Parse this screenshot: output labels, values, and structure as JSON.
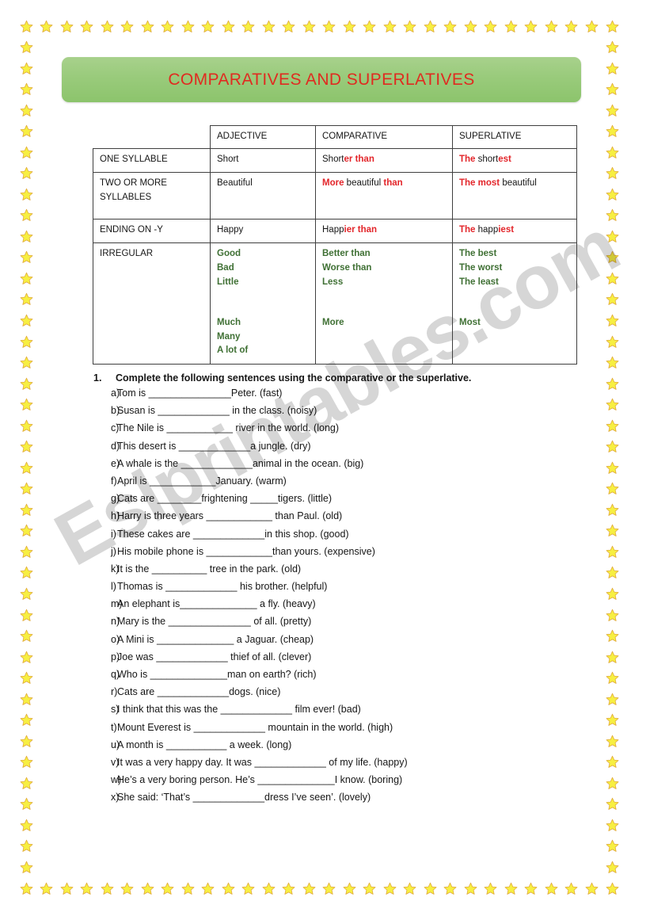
{
  "banner": {
    "title": "COMPARATIVES AND SUPERLATIVES",
    "bg_color": "#9acb7c",
    "title_color": "#e02b20"
  },
  "watermark": {
    "text": "Eslprintables.com"
  },
  "colors": {
    "red": "#e3252a",
    "green": "#3f7034",
    "border": "#3f3f3f"
  },
  "table": {
    "headers": [
      "",
      "ADJECTIVE",
      "COMPARATIVE",
      "SUPERLATIVE"
    ],
    "rows": [
      {
        "category": "ONE SYLLABLE",
        "adjective": "Short",
        "comparative_plain": "Short",
        "comparative_red": "er than",
        "superlative_red": "The ",
        "superlative_plain": "short",
        "superlative_red2": "est"
      },
      {
        "category": "TWO OR MORE SYLLABLES",
        "adjective": "Beautiful",
        "comparative_red": "More",
        "comparative_plain": " beautiful ",
        "comparative_red2": "than",
        "superlative_red": "The most",
        "superlative_plain": " beautiful"
      },
      {
        "category": "ENDING ON -Y",
        "adjective": "Happy",
        "comparative_plain": "Happ",
        "comparative_red": "ier than",
        "superlative_red": "The ",
        "superlative_plain": "happ",
        "superlative_red2": "iest"
      }
    ],
    "irregular": {
      "category": "IRREGULAR",
      "adjectives_top": [
        "Good",
        "Bad",
        "Little"
      ],
      "adjectives_bottom": [
        "Much",
        "Many",
        "A lot of"
      ],
      "comparatives_top": [
        "Better than",
        "Worse than",
        "Less"
      ],
      "comparatives_bottom": [
        "More"
      ],
      "superlatives_top": [
        "The best",
        "The worst",
        "The least"
      ],
      "superlatives_bottom": [
        "Most"
      ]
    }
  },
  "exercise": {
    "number": "1.",
    "instruction": "Complete the following sentences using the comparative or the superlative.",
    "items": [
      {
        "letter": "a)",
        "text": "Tom is _______________Peter. (fast)"
      },
      {
        "letter": "b)",
        "text": "Susan is _____________ in the class. (noisy)"
      },
      {
        "letter": "c)",
        "text": "The Nile is ____________ river in the world. (long)"
      },
      {
        "letter": "d)",
        "text": "This desert is _____________a jungle. (dry)"
      },
      {
        "letter": "e)",
        "text": "A whale is the _____________animal in the ocean. (big)"
      },
      {
        "letter": "f)",
        "text": "April is ____________January. (warm)"
      },
      {
        "letter": "g)",
        "text": "Cats are ________frightening _____tigers. (little)"
      },
      {
        "letter": "h)",
        "text": "Harry is three years ____________ than Paul. (old)"
      },
      {
        "letter": "i)",
        "text": "These cakes are _____________in this shop. (good)"
      },
      {
        "letter": "j)",
        "text": "His mobile phone is ____________than yours. (expensive)"
      },
      {
        "letter": "k)",
        "text": "It is the __________ tree in the park. (old)"
      },
      {
        "letter": "l)",
        "text": "Thomas is _____________ his brother. (helpful)"
      },
      {
        "letter": "m)",
        "text": "An elephant is______________ a fly. (heavy)"
      },
      {
        "letter": "n)",
        "text": "Mary is the _______________ of all. (pretty)"
      },
      {
        "letter": "o)",
        "text": "A Mini is ______________ a Jaguar. (cheap)"
      },
      {
        "letter": "p)",
        "text": "Joe was _____________ thief of all. (clever)"
      },
      {
        "letter": "q)",
        "text": "Who is ______________man on earth? (rich)"
      },
      {
        "letter": "r)",
        "text": "Cats are _____________dogs. (nice)"
      },
      {
        "letter": "s)",
        "text": "I think that this was the _____________ film ever! (bad)"
      },
      {
        "letter": "t)",
        "text": "Mount Everest is _____________ mountain in the world. (high)"
      },
      {
        "letter": "u)",
        "text": "A month is ___________ a week. (long)"
      },
      {
        "letter": "v)",
        "text": "It was a very happy day. It was _____________ of my life. (happy)"
      },
      {
        "letter": "w)",
        "text": "He’s a very boring person. He’s ______________I know. (boring)"
      },
      {
        "letter": "x)",
        "text": "She said: ‘That’s _____________dress I’ve seen’. (lovely)"
      }
    ]
  }
}
